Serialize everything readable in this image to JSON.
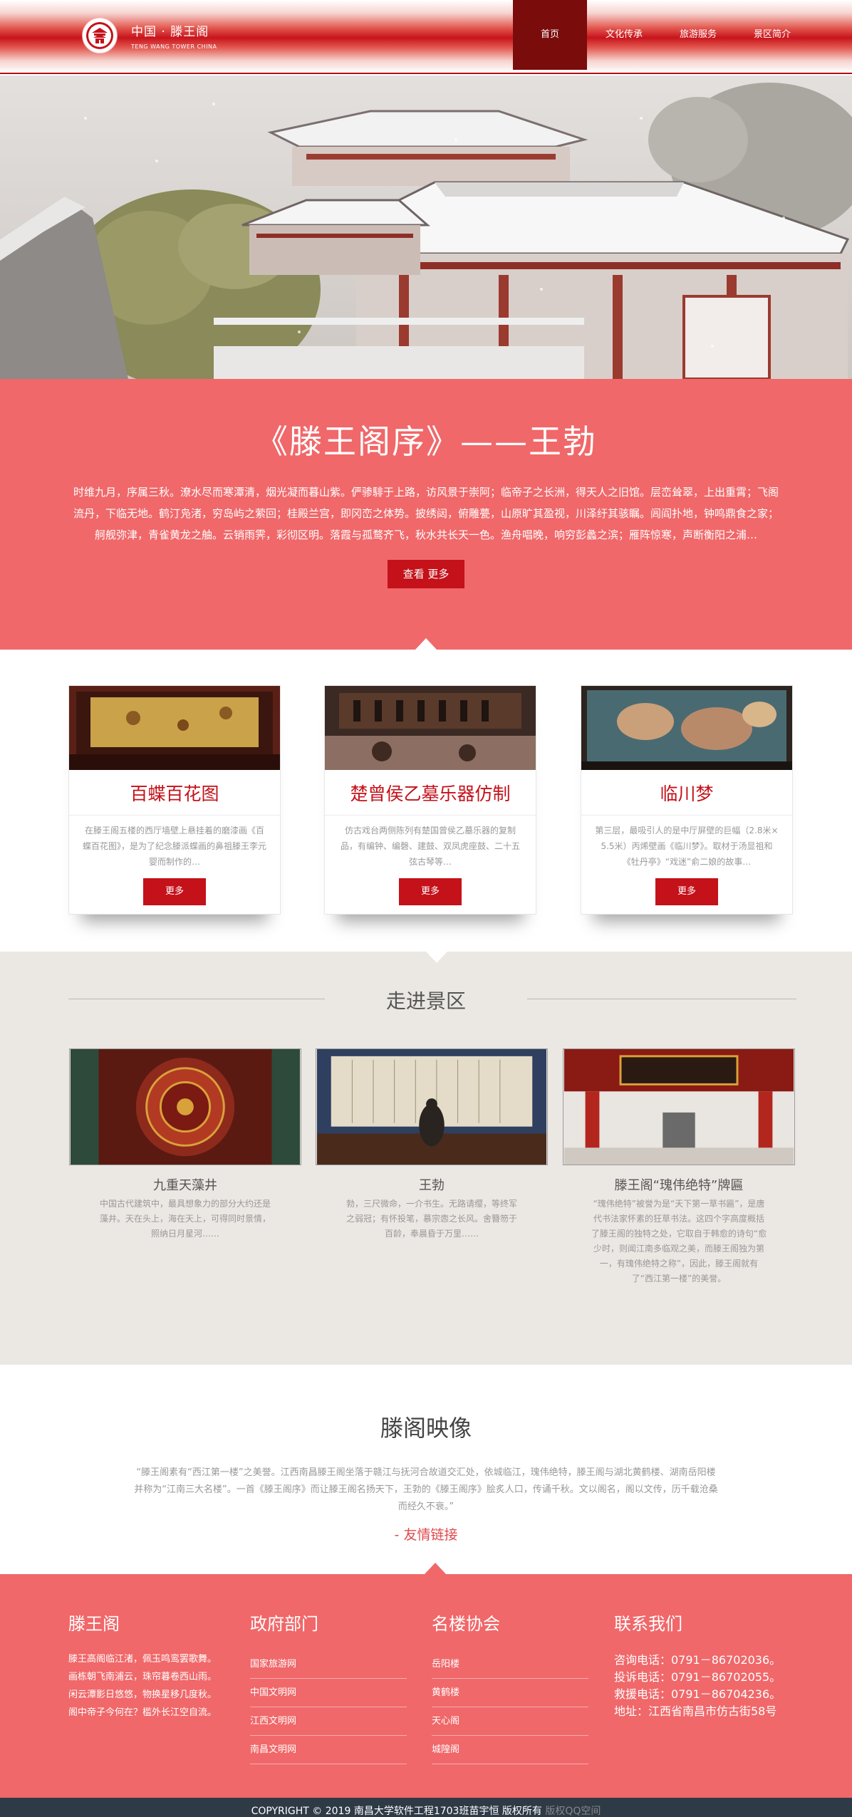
{
  "header": {
    "brand_cn": "中国 · 滕王阁",
    "brand_en": "TENG WANG TOWER    CHINA",
    "nav": [
      "首页",
      "文化传承",
      "旅游服务",
      "景区简介"
    ]
  },
  "preface": {
    "title": "《滕王阁序》——王勃",
    "text": "时维九月，序属三秋。潦水尽而寒潭清，烟光凝而暮山紫。俨骖騑于上路，访风景于崇阿；临帝子之长洲，得天人之旧馆。层峦耸翠，上出重霄；飞阁流丹，下临无地。鹤汀凫渚，穷岛屿之萦回；桂殿兰宫，即冈峦之体势。披绣闼，俯雕甍，山原旷其盈视，川泽纡其骇瞩。闾阎扑地，钟鸣鼎食之家；舸舰弥津，青雀黄龙之舳。云销雨霁，彩彻区明。落霞与孤鹜齐飞，秋水共长天一色。渔舟唱晚，响穷彭蠡之滨；雁阵惊寒，声断衡阳之浦…",
    "button": "查看 更多"
  },
  "cards": [
    {
      "title": "百蝶百花图",
      "text": "在滕王阁五楼的西厅墙壁上悬挂着的磨漆画《百蝶百花图》，是为了纪念滕派蝶画的鼻祖滕王李元婴而制作的…",
      "button": "更多"
    },
    {
      "title": "楚曾侯乙墓乐器仿制",
      "text": "仿古戏台两侧陈列有楚国曾侯乙墓乐器的复制品，有编钟、编磬、建鼓、双凤虎座鼓、二十五弦古琴等…",
      "button": "更多"
    },
    {
      "title": "临川梦",
      "text": "第三层，最吸引人的是中厅屏壁的巨幅（2.8米× 5.5米）丙烯壁画《临川梦》。取材于汤显祖和《牡丹亭》“戏迷”俞二娘的故事…",
      "button": "更多"
    }
  ],
  "scenic": {
    "title": "走进景区",
    "spots": [
      {
        "title": "九重天藻井",
        "text": "中国古代建筑中，最具想象力的部分大约还是藻井。天在头上，海在天上，可得同时景情，照纳日月星河……"
      },
      {
        "title": "王勃",
        "text": "勃，三尺微命，一介书生。无路请缨，等终军之弱冠；有怀投笔，慕宗悫之长风。舍簪笏于百龄，奉晨昏于万里……"
      },
      {
        "title": "滕王阁“瑰伟绝特”牌匾",
        "text": "“瑰伟绝特”被誉为是“天下第一草书匾”，是唐代书法家怀素的狂草书法。这四个字高度概括了滕王阁的独特之处，它取自于韩愈的诗句“愈少时，则闻江南多临观之美，而滕王阁独为第一，有瑰伟绝特之称”，因此，滕王阁就有了“西江第一楼”的美誉。"
      }
    ]
  },
  "yingxiang": {
    "title": "滕阁映像",
    "text": "“滕王阁素有“西江第一楼”之美誉。江西南昌滕王阁坐落于赣江与抚河合故道交汇处，依城临江，瑰伟绝特，滕王阁与湖北黄鹤楼、湖南岳阳楼并称为“江南三大名楼”。一首《滕王阁序》而让滕王阁名扬天下，王勃的《滕王阁序》脍炙人口，传诵千秋。文以阁名，阁以文传，历千载沧桑而经久不衰。”",
    "link": "- 友情链接"
  },
  "footer": {
    "about": {
      "title": "滕王阁",
      "lines": [
        "滕王高阁临江渚，佩玉鸣鸾罢歌舞。",
        "画栋朝飞南浦云，珠帘暮卷西山雨。",
        "闲云潭影日悠悠，物换星移几度秋。",
        "阁中帝子今何在？槛外长江空自流。"
      ]
    },
    "gov": {
      "title": "政府部门",
      "items": [
        "国家旅游网",
        "中国文明网",
        "江西文明网",
        "南昌文明网"
      ]
    },
    "assoc": {
      "title": "名楼协会",
      "items": [
        "岳阳楼",
        "黄鹤楼",
        "天心阁",
        "城隍阁"
      ]
    },
    "contact": {
      "title": "联系我们",
      "lines": [
        "咨询电话：0791－86702036。",
        "投诉电话：0791－86702055。",
        "救援电话：0791－86704236。",
        "地址：江西省南昌市仿古街58号"
      ]
    },
    "copyright": "COPYRIGHT © 2019 南昌大学软件工程1703班苗宇恒 版权所有",
    "copyright_dim": " 版权QQ空间"
  },
  "colors": {
    "accent": "#c4111a",
    "salmon": "#f0686a",
    "beige": "#ebe7e3",
    "dark": "#2f3a47"
  }
}
